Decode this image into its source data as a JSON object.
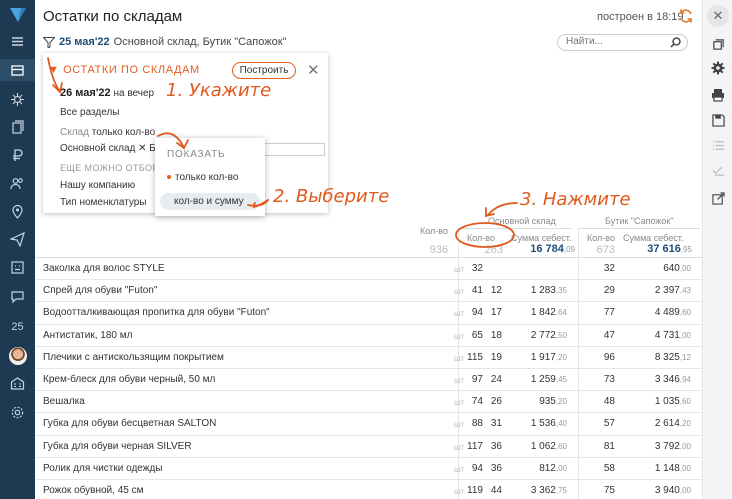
{
  "app": {
    "title": "Остатки по складам",
    "built": "построен в 18:19"
  },
  "filter": {
    "date": "25 мая'22",
    "warehouses": "Основной склад, Бутик \"Сапожок\"",
    "search_placeholder": "Найти..."
  },
  "panel": {
    "title": "ОСТАТКИ ПО СКЛАДАМ",
    "build_button": "Построить",
    "date": "26 мая'22",
    "date_suffix": "на вечер",
    "sections": "Все разделы",
    "warehouse_label": "Склад",
    "warehouse_mode": "только кол-во",
    "chip1": "Основной склад",
    "chip2": "Б",
    "more": "ЕЩЕ МОЖНО ОТБОР",
    "company": "Нашу компанию",
    "nomen": "Тип номенклатуры"
  },
  "dropdown": {
    "header": "ПОКАЗАТЬ",
    "opt1": "только кол-во",
    "opt2": "кол-во и сумму"
  },
  "annotations": {
    "a1": "1. Укажите",
    "a2": "2. Выберите",
    "a3": "3. Нажмите"
  },
  "table": {
    "col_qty": "Кол-во",
    "group1": "Основной склад",
    "group2": "Бутик \"Сапожок\"",
    "g1_qty": "Кол-во",
    "g1_sum": "Сумма себест.",
    "g2_qty": "Кол-во",
    "g2_sum": "Сумма себест.",
    "total_qty": "936",
    "g1_total_qty": "263",
    "g1_total_sum": "16 784",
    "g1_total_sum_dec": ",09",
    "g2_total_qty": "673",
    "g2_total_sum": "37 616",
    "g2_total_sum_dec": ",95",
    "unit": "шт",
    "rows": [
      {
        "name": "Заколка для волос STYLE",
        "q": "32",
        "q1": "",
        "s1": "",
        "s1d": "",
        "q2": "32",
        "s2": "640",
        "s2d": ",00"
      },
      {
        "name": "Спрей для обуви \"Futon\"",
        "q": "41",
        "q1": "12",
        "s1": "1 283",
        "s1d": ",35",
        "q2": "29",
        "s2": "2 397",
        "s2d": ",43"
      },
      {
        "name": "Водоотталкивающая пропитка для обуви \"Futon\"",
        "q": "94",
        "q1": "17",
        "s1": "1 842",
        "s1d": ",64",
        "q2": "77",
        "s2": "4 489",
        "s2d": ",60"
      },
      {
        "name": "Антистатик, 180 мл",
        "q": "65",
        "q1": "18",
        "s1": "2 772",
        "s1d": ",50",
        "q2": "47",
        "s2": "4 731",
        "s2d": ",00"
      },
      {
        "name": "Плечики с антискользящим покрытием",
        "q": "115",
        "q1": "19",
        "s1": "1 917",
        "s1d": ",20",
        "q2": "96",
        "s2": "8 325",
        "s2d": ",12"
      },
      {
        "name": "Крем-блеск для обуви черный, 50 мл",
        "q": "97",
        "q1": "24",
        "s1": "1 259",
        "s1d": ",45",
        "q2": "73",
        "s2": "3 346",
        "s2d": ",94"
      },
      {
        "name": "Вешалка",
        "q": "74",
        "q1": "26",
        "s1": "935",
        "s1d": ",20",
        "q2": "48",
        "s2": "1 035",
        "s2d": ",60"
      },
      {
        "name": "Губка для обуви бесцветная SALTON",
        "q": "88",
        "q1": "31",
        "s1": "1 536",
        "s1d": ",40",
        "q2": "57",
        "s2": "2 614",
        "s2d": ",20"
      },
      {
        "name": "Губка для обуви черная SILVER",
        "q": "117",
        "q1": "36",
        "s1": "1 062",
        "s1d": ",60",
        "q2": "81",
        "s2": "3 792",
        "s2d": ",00"
      },
      {
        "name": "Ролик для чистки одежды",
        "q": "94",
        "q1": "36",
        "s1": "812",
        "s1d": ",00",
        "q2": "58",
        "s2": "1 148",
        "s2d": ",00"
      },
      {
        "name": "Рожок обувной, 45 см",
        "q": "119",
        "q1": "44",
        "s1": "3 362",
        "s1d": ",75",
        "q2": "75",
        "s2": "3 940",
        "s2d": ",00"
      }
    ]
  },
  "nav": {
    "num25": "25"
  }
}
